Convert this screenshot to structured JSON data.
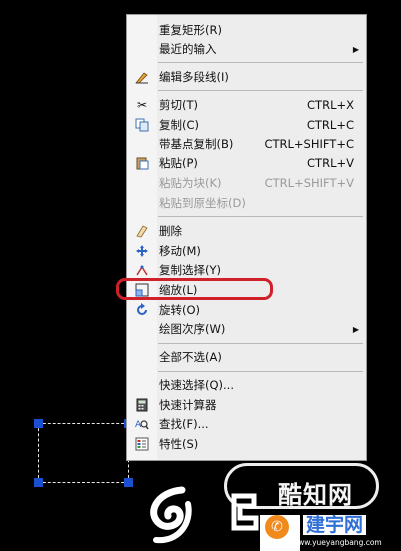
{
  "menu": {
    "items": [
      {
        "label": "重复矩形(R)",
        "shortcut": "",
        "submenu": false,
        "icon": "",
        "disabled": false
      },
      {
        "label": "最近的输入",
        "shortcut": "",
        "submenu": true,
        "icon": "",
        "disabled": false
      },
      {
        "label": "编辑多段线(I)",
        "shortcut": "",
        "submenu": false,
        "icon": "polyline-edit-icon",
        "disabled": false
      },
      {
        "label": "剪切(T)",
        "shortcut": "CTRL+X",
        "submenu": false,
        "icon": "scissors-icon",
        "disabled": false
      },
      {
        "label": "复制(C)",
        "shortcut": "CTRL+C",
        "submenu": false,
        "icon": "copy-icon",
        "disabled": false
      },
      {
        "label": "带基点复制(B)",
        "shortcut": "CTRL+SHIFT+C",
        "submenu": false,
        "icon": "",
        "disabled": false
      },
      {
        "label": "粘贴(P)",
        "shortcut": "CTRL+V",
        "submenu": false,
        "icon": "paste-icon",
        "disabled": false
      },
      {
        "label": "粘贴为块(K)",
        "shortcut": "CTRL+SHIFT+V",
        "submenu": false,
        "icon": "",
        "disabled": true
      },
      {
        "label": "粘贴到原坐标(D)",
        "shortcut": "",
        "submenu": false,
        "icon": "",
        "disabled": true
      },
      {
        "label": "删除",
        "shortcut": "",
        "submenu": false,
        "icon": "eraser-icon",
        "disabled": false
      },
      {
        "label": "移动(M)",
        "shortcut": "",
        "submenu": false,
        "icon": "move-icon",
        "disabled": false
      },
      {
        "label": "复制选择(Y)",
        "shortcut": "",
        "submenu": false,
        "icon": "copy-selection-icon",
        "disabled": false
      },
      {
        "label": "缩放(L)",
        "shortcut": "",
        "submenu": false,
        "icon": "scale-icon",
        "disabled": false
      },
      {
        "label": "旋转(O)",
        "shortcut": "",
        "submenu": false,
        "icon": "rotate-icon",
        "disabled": false
      },
      {
        "label": "绘图次序(W)",
        "shortcut": "",
        "submenu": true,
        "icon": "",
        "disabled": false
      },
      {
        "label": "全部不选(A)",
        "shortcut": "",
        "submenu": false,
        "icon": "",
        "disabled": false
      },
      {
        "label": "快速选择(Q)...",
        "shortcut": "",
        "submenu": false,
        "icon": "",
        "disabled": false
      },
      {
        "label": "快速计算器",
        "shortcut": "",
        "submenu": false,
        "icon": "calculator-icon",
        "disabled": false
      },
      {
        "label": "查找(F)...",
        "shortcut": "",
        "submenu": false,
        "icon": "find-icon",
        "disabled": false
      },
      {
        "label": "特性(S)",
        "shortcut": "",
        "submenu": false,
        "icon": "properties-icon",
        "disabled": false
      }
    ]
  },
  "watermark": {
    "badge_text": "酷知网",
    "site_name": "建宇网",
    "site_url": "www.yueyangbang.com"
  },
  "colors": {
    "highlight": "#d0202a",
    "grip": "#1a4fd0",
    "menu_bg": "#ededed"
  }
}
